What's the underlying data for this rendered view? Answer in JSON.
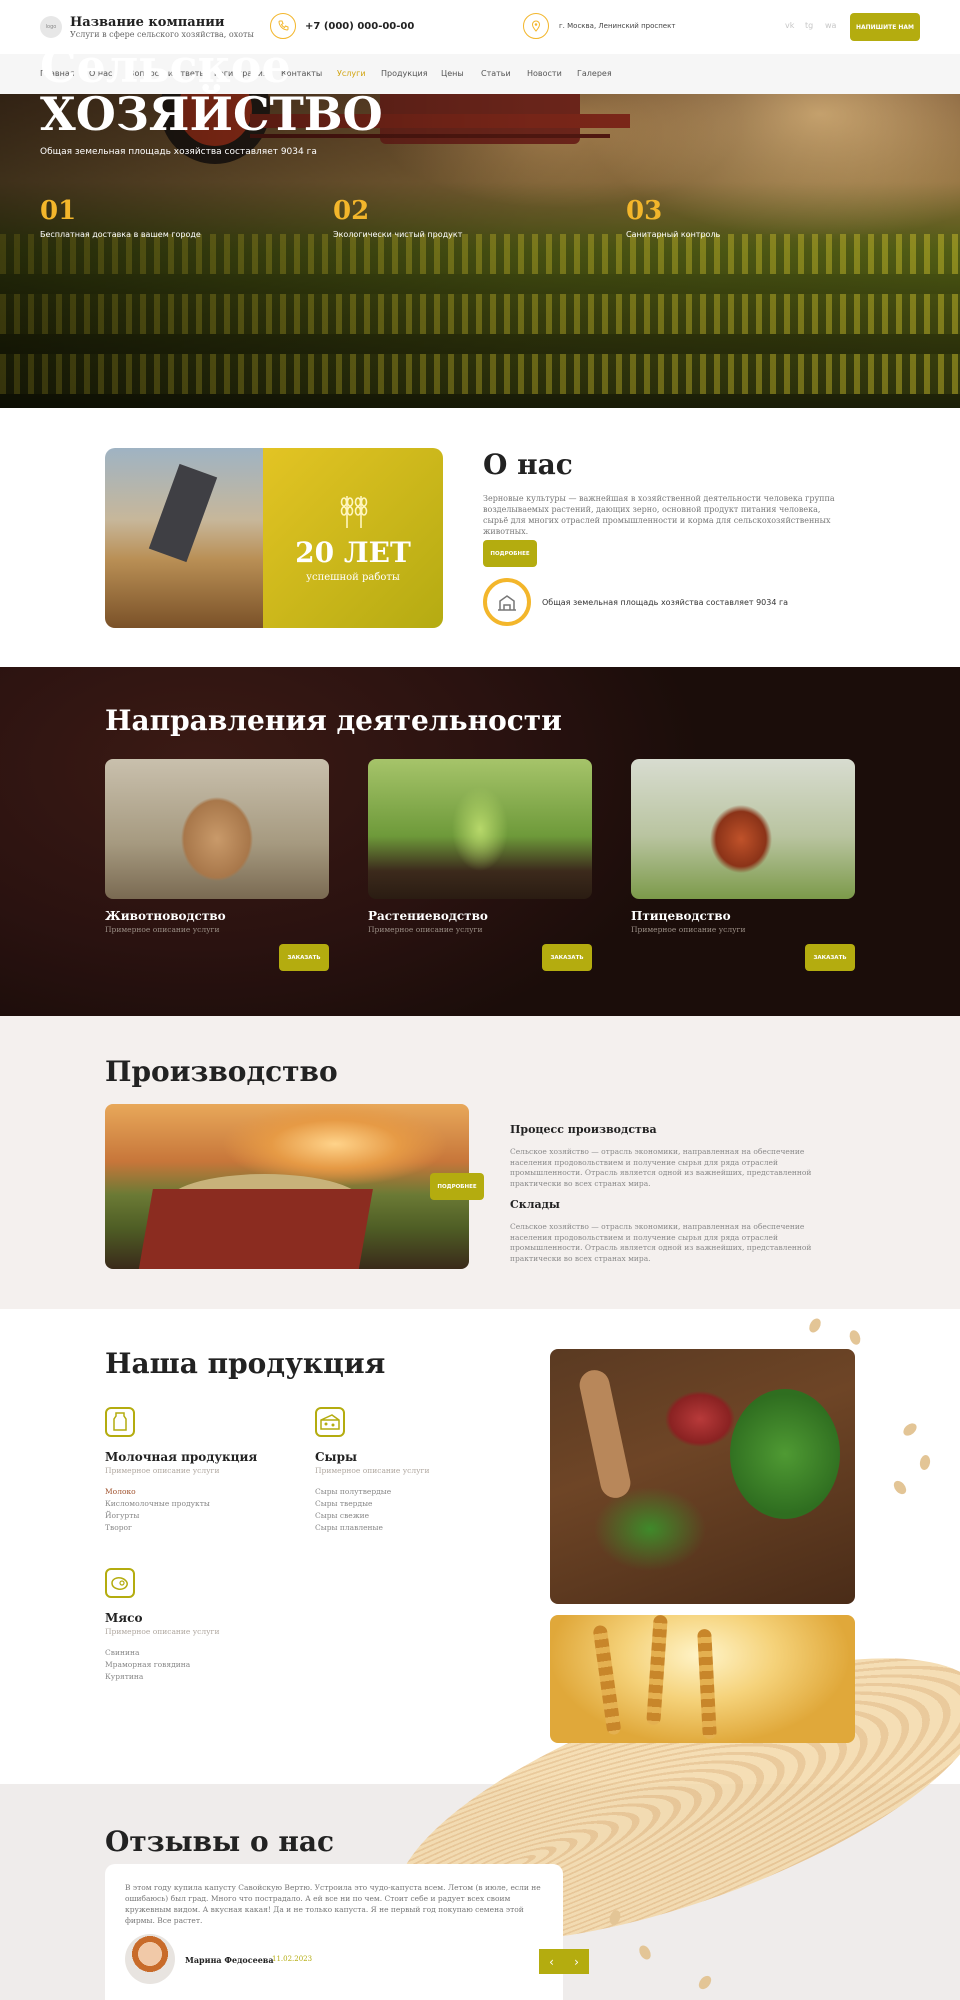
{
  "header": {
    "logo_text": "logo",
    "company_name": "Название компании",
    "company_sub": "Услуги в сфере сельского хозяйства, охоты",
    "phone": "+7 (000) 000-00-00",
    "address": "г. Москва, Ленинский проспект",
    "social": [
      "vk",
      "tg",
      "wa"
    ],
    "cta": "НАПИШИТЕ НАМ"
  },
  "nav": {
    "items": [
      "Главная",
      "О нас",
      "Вопросы и ответы",
      "Регистрация",
      "Контакты",
      "Услуги",
      "Продукция",
      "Цены",
      "Статьи",
      "Новости",
      "Галерея"
    ],
    "active": "Услуги"
  },
  "hero": {
    "title_line1": "Сельское",
    "title_line2": "ХОЗЯЙСТВО",
    "subtitle": "Общая земельная площадь хозяйства составляет 9034 га",
    "stats": [
      {
        "num": "01",
        "label": "Бесплатная доставка в вашем городе"
      },
      {
        "num": "02",
        "label": "Экологически чистый продукт"
      },
      {
        "num": "03",
        "label": "Санитарный контроль"
      }
    ]
  },
  "about": {
    "years": "20 ЛЕТ",
    "years_sub": "успешной работы",
    "title": "О нас",
    "text": "Зерновые культуры — важнейшая в хозяйственной деятельности человека группа возделываемых растений, дающих зерно, основной продукт питания человека, сырьё для многих отраслей промышленности и корма для сельскохозяйственных животных.",
    "button": "ПОДРОБНЕЕ",
    "area_text": "Общая земельная площадь хозяйства составляет 9034 га"
  },
  "directions": {
    "title": "Направления деятельности",
    "cards": [
      {
        "name": "Животноводство",
        "desc": "Примерное описание услуги",
        "button": "ЗАКАЗАТЬ"
      },
      {
        "name": "Растениеводство",
        "desc": "Примерное описание услуги",
        "button": "ЗАКАЗАТЬ"
      },
      {
        "name": "Птицеводство",
        "desc": "Примерное описание услуги",
        "button": "ЗАКАЗАТЬ"
      }
    ]
  },
  "production": {
    "title": "Производство",
    "button": "ПОДРОБНЕЕ",
    "sections": [
      {
        "heading": "Процесс производства",
        "text": "Сельское хозяйство — отрасль экономики, направленная на обеспечение населения продовольствием и получение сырья для ряда отраслей промышленности. Отрасль является одной из важнейших, представленной практически во всех странах мира."
      },
      {
        "heading": "Склады",
        "text": "Сельское хозяйство — отрасль экономики, направленная на обеспечение населения продовольствием и получение сырья для ряда отраслей промышленности. Отрасль является одной из важнейших, представленной практически во всех странах мира."
      }
    ]
  },
  "products": {
    "title": "Наша продукция",
    "categories": [
      {
        "name": "Молочная продукция",
        "desc": "Примерное описание услуги",
        "items": [
          "Молоко",
          "Кисломолочные продукты",
          "Йогурты",
          "Творог"
        ]
      },
      {
        "name": "Сыры",
        "desc": "Примерное описание услуги",
        "items": [
          "Сыры полутвердые",
          "Сыры твердые",
          "Сыры свежие",
          "Сыры плавленые"
        ]
      },
      {
        "name": "Мясо",
        "desc": "Примерное описание услуги",
        "items": [
          "Свинина",
          "Мраморная говядина",
          "Курятина"
        ]
      }
    ]
  },
  "reviews": {
    "title": "Отзывы о нас",
    "text": "В этом году купила капусту Савойскую Вертю. Устроила это чудо-капуста всем. Летом (в июле, если не ошибаюсь) был град. Много что пострадало. А ей все ни по чем. Стоит себе и радует всех своим кружевным видом. А вкусная какая! Да и не только капуста. Я не первый год покупаю семена этой фирмы. Все растет.",
    "author": "Марина Федосеева",
    "date": "11.02.2023",
    "prev": "‹",
    "next": "›"
  },
  "colors": {
    "accent": "#b4ac0f",
    "gold": "#f3b62b",
    "dark": "#2a1210"
  }
}
